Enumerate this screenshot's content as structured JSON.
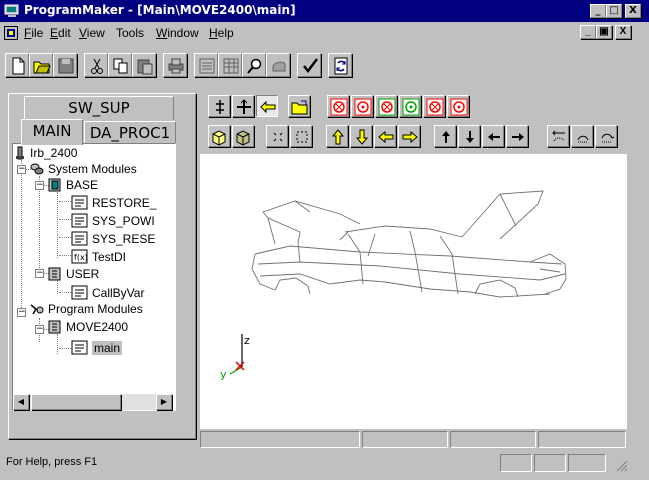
{
  "window": {
    "title": "ProgramMaker - [Main\\MOVE2400\\main]",
    "caption_buttons": [
      "_",
      "□",
      "X"
    ],
    "mdi_buttons": [
      "_",
      "▣",
      "X"
    ]
  },
  "menu": [
    {
      "u": "F",
      "rest": "ile"
    },
    {
      "u": "E",
      "rest": "dit"
    },
    {
      "u": "V",
      "rest": "iew"
    },
    {
      "u": "",
      "rest": "Tools"
    },
    {
      "u": "W",
      "rest": "indow"
    },
    {
      "u": "H",
      "rest": "elp"
    }
  ],
  "tabs": {
    "back": "SW_SUP",
    "main": "MAIN",
    "other": "DA_PROC1"
  },
  "tree": {
    "root": "Irb_2400",
    "system_modules": "System Modules",
    "base": "BASE",
    "restore": "RESTORE_",
    "sys_powr": "SYS_POWI",
    "sys_rese": "SYS_RESE",
    "testdi": "TestDI",
    "user": "USER",
    "callbyvar": "CallByVar",
    "program_modules": "Program Modules",
    "move2400": "MOVE2400",
    "main": "main"
  },
  "viewport": {
    "axis_z": "z",
    "axis_y": "y"
  },
  "status": {
    "help": "For Help, press F1"
  },
  "colors": {
    "title_bar": "#000080",
    "face": "#c0c0c0",
    "selected_item": "#c0c0c0",
    "axis_green": "#00a000",
    "axis_red": "#e00000"
  }
}
